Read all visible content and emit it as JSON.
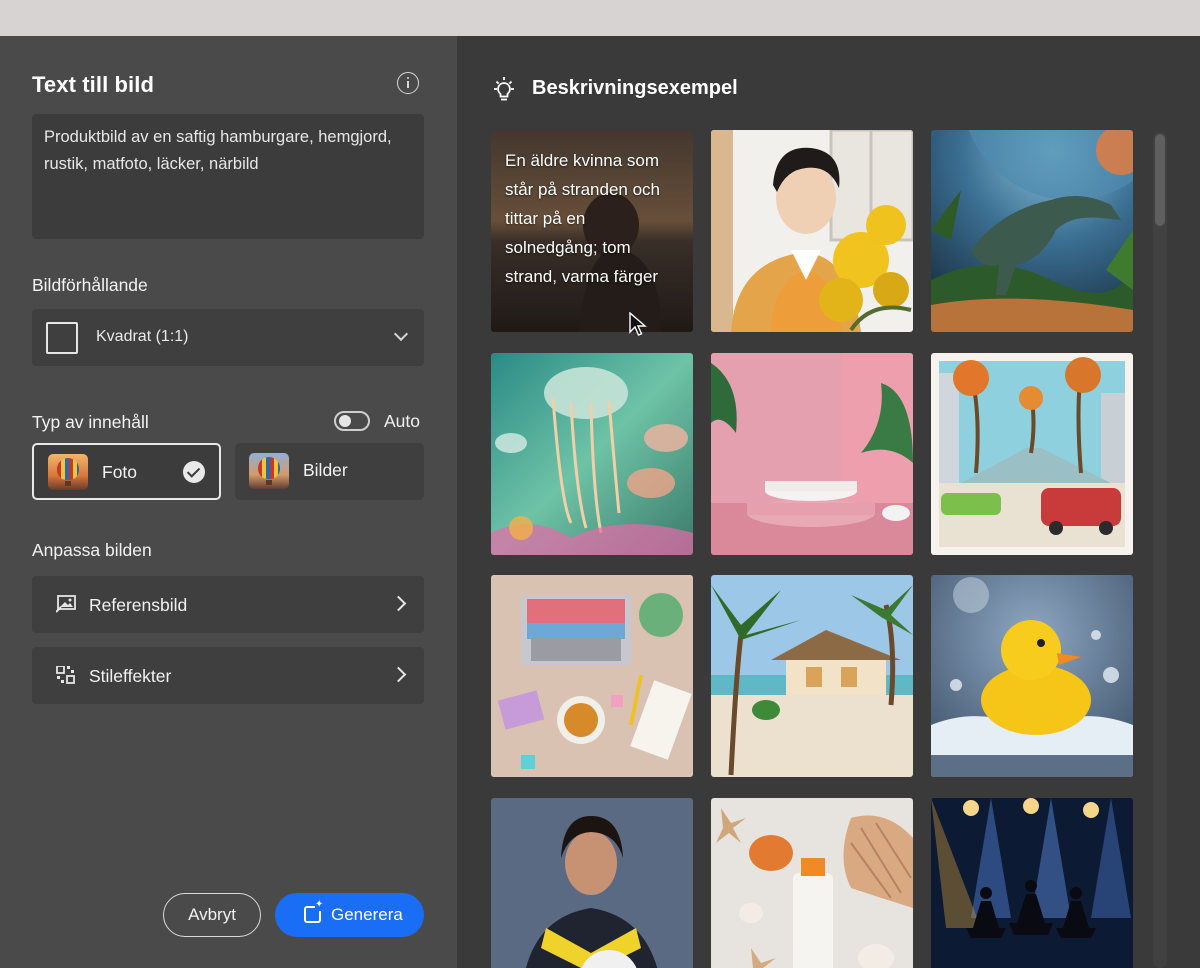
{
  "left_panel": {
    "title": "Text till bild",
    "prompt_text": "Produktbild av en saftig hamburgare, hemgjord, rustik, matfoto, läcker, närbild",
    "aspect_label": "Bildförhållande",
    "aspect_value": "Kvadrat (1:1)",
    "content_type_label": "Typ av innehåll",
    "auto_label": "Auto",
    "auto_enabled": false,
    "content_types": [
      {
        "label": "Foto",
        "selected": true
      },
      {
        "label": "Bilder",
        "selected": false
      }
    ],
    "customize_label": "Anpassa bilden",
    "reference_label": "Referensbild",
    "style_effects_label": "Stileffekter",
    "cancel_label": "Avbryt",
    "generate_label": "Generera",
    "accent_color": "#1a6ef5"
  },
  "right_panel": {
    "title": "Beskrivningsexempel",
    "first_example_text": "En äldre kvinna som står på stranden och tittar på en solnedgång; tom strand, varma färger",
    "examples": [
      "beach-sunset-woman",
      "illustrated-young-man-mimosa",
      "dinosaur-planet",
      "watercolor-jellyfish",
      "pink-podium-palm-leaves",
      "retro-cars-palm-street",
      "desk-laptop-tea",
      "beach-hut-palms",
      "rubber-duck-bubbles",
      "woman-soccer-ball",
      "seashells-serum-bottle",
      "ballet-stage-lights"
    ]
  }
}
